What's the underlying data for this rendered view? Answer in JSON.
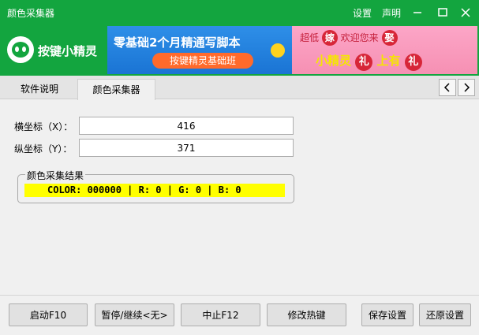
{
  "window": {
    "title": "颜色采集器",
    "links": [
      "设置",
      "声明"
    ]
  },
  "brand": {
    "name": "按键小精灵"
  },
  "ads": [
    {
      "headline": "零基础2个月精通写脚本",
      "button": "按键精灵基础班"
    },
    {
      "line1_prefix": "超低",
      "line1_circle": "嫁",
      "line1_mid": "欢迎您来",
      "line1_circle2": "娶",
      "line2_a": "小精灵",
      "line2_circle": "礼",
      "line2_b": "上有",
      "line2_circle2": "礼"
    }
  ],
  "tabs": [
    {
      "label": "软件说明",
      "active": false
    },
    {
      "label": "颜色采集器",
      "active": true
    }
  ],
  "tab_nav": {
    "prev": "<",
    "next": ">"
  },
  "fields": {
    "x": {
      "label": "横坐标（X）：",
      "value": "416"
    },
    "y": {
      "label": "纵坐标（Y）：",
      "value": "371"
    }
  },
  "result": {
    "legend": "颜色采集结果",
    "text": "COLOR: 000000 | R: 0 | G: 0 | B: 0",
    "highlight_color": "#ffff00"
  },
  "buttons": {
    "start": "启动F10",
    "pause": "暂停/继续<无>",
    "stop": "中止F12",
    "hotkey": "修改热键",
    "save": "保存设置",
    "restore": "还原设置"
  },
  "colors": {
    "brand_green": "#13a53f"
  }
}
